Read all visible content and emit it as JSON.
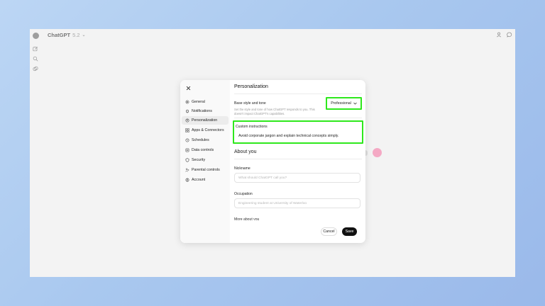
{
  "app": {
    "title": "ChatGPT",
    "version": "5.2"
  },
  "modal": {
    "nav": [
      {
        "label": "General",
        "icon": "gear-icon"
      },
      {
        "label": "Notifications",
        "icon": "bell-icon"
      },
      {
        "label": "Personalization",
        "icon": "personalization-icon",
        "active": true
      },
      {
        "label": "Apps & Connectors",
        "icon": "apps-grid-icon"
      },
      {
        "label": "Schedules",
        "icon": "clock-icon"
      },
      {
        "label": "Data controls",
        "icon": "data-controls-icon"
      },
      {
        "label": "Security",
        "icon": "shield-icon"
      },
      {
        "label": "Parental controls",
        "icon": "parental-icon"
      },
      {
        "label": "Account",
        "icon": "account-icon"
      }
    ],
    "title": "Personalization",
    "base_style": {
      "label": "Base style and tone",
      "description": "Set the style and tone of how ChatGPT responds to you. This doesn't impact ChatGPT's capabilities.",
      "value": "Professional"
    },
    "custom_instructions": {
      "label": "Custom instructions",
      "value": "Avoid corporate jargon and explain technical concepts simply."
    },
    "about": {
      "title": "About you",
      "nickname": {
        "label": "Nickname",
        "placeholder": "What should ChatGPT call you?"
      },
      "occupation": {
        "label": "Occupation",
        "placeholder": "Engineering student at University of Waterloo"
      },
      "more": {
        "label": "More about you"
      }
    },
    "buttons": {
      "cancel": "Cancel",
      "save": "Save"
    }
  },
  "colors": {
    "highlight": "#2ee81c",
    "save_button": "#111111",
    "accent_pink": "#f4a9c4"
  }
}
